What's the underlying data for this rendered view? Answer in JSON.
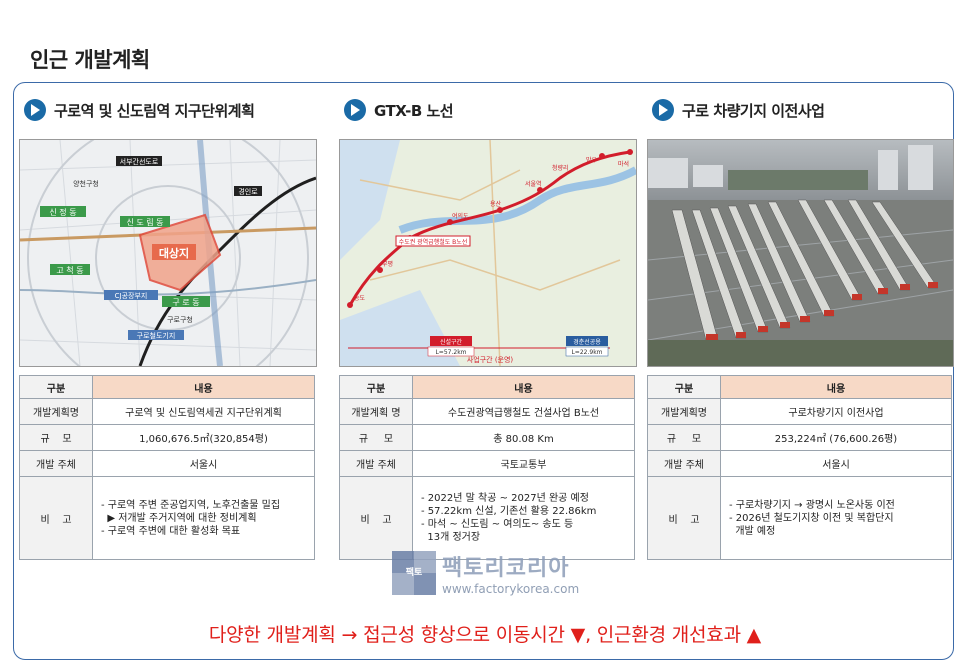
{
  "page_title": "인근 개발계획",
  "columns": [
    {
      "title": "구로역 및 신도림역 지구단위계획",
      "map_labels": [
        "대상지",
        "구 로 동",
        "신 도 림 동",
        "CJ공장부지",
        "구로철도기지",
        "서부간선도로",
        "경인로",
        "구로구청",
        "신 정 동",
        "고 척 동",
        "양천구청"
      ],
      "table": {
        "head": [
          "구분",
          "내용"
        ],
        "rows": [
          [
            "개발계획명",
            "구로역 및 신도림역세권 지구단위계획"
          ],
          [
            "규    모",
            "1,060,676.5㎡(320,854평)"
          ],
          [
            "개발 주체",
            "서울시"
          ]
        ],
        "note_key": "비    고",
        "notes": [
          "- 구로역 주변 준공업지역, 노후건출물 밀집",
          "  ▶ 저개발 주거지역에 대한 정비계획",
          "- 구로역 주변에 대한 활성화 목표"
        ]
      }
    },
    {
      "title": "GTX-B 노선",
      "map_labels": [
        "신설구간",
        "L=57.2km",
        "경춘선공용",
        "L=22.9km",
        "사업구간 (운영)",
        "수도권 광역급행철도 B노선",
        "부평",
        "송도",
        "여의도",
        "용산",
        "서울역",
        "청량리",
        "망우",
        "마석"
      ],
      "table": {
        "head": [
          "구분",
          "내용"
        ],
        "rows": [
          [
            "개발계획 명",
            "수도권광역급행철도 건설사업 B노선"
          ],
          [
            "규     모",
            "총 80.08 Km"
          ],
          [
            "개발 주체",
            "국토교통부"
          ]
        ],
        "note_key": "비    고",
        "notes": [
          "- 2022년 말 착공 ~ 2027년 완공 예정",
          "- 57.22km 신설, 기존선 활용 22.86km",
          "- 마석 ~ 신도림 ~ 여의도~ 송도 등",
          "  13개 정거장"
        ]
      }
    },
    {
      "title": "구로 차량기지 이전사업",
      "table": {
        "head": [
          "구분",
          "내용"
        ],
        "rows": [
          [
            "개발계획명",
            "구로차량기지 이전사업"
          ],
          [
            "규     모",
            "253,224㎡ (76,600.26평)"
          ],
          [
            "개발 주체",
            "서울시"
          ]
        ],
        "note_key": "비    고",
        "notes": [
          "- 구로차량기지 → 광명시 노온사동 이전",
          "- 2026년 철도기지창 이전 및 복합단지",
          "  개발 예정"
        ]
      }
    }
  ],
  "watermark": {
    "logo_text": "팩토",
    "name": "팩토리코리아",
    "url": "www.factorykorea.com"
  },
  "slogan": "다양한 개발계획 → 접근성 향상으로 이동시간 ▼, 인근환경 개선효과 ▲",
  "colors": {
    "accent": "#1a6aa6",
    "border": "#3b6aa8",
    "table_head": "#f7d9c6",
    "slogan": "#e0201b"
  }
}
